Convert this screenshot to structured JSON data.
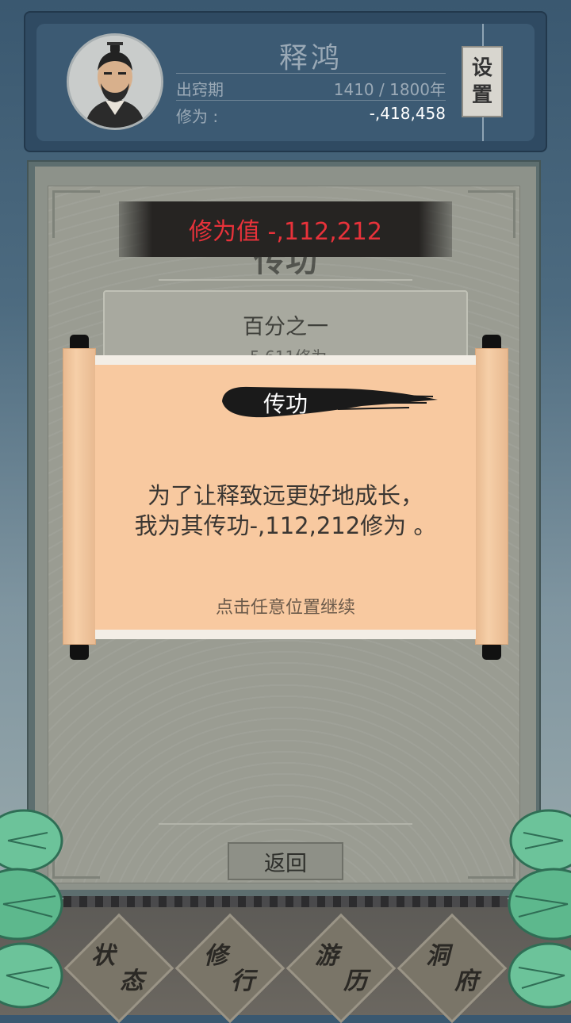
{
  "player": {
    "name": "释鸿",
    "stage_label": "出窍期",
    "stage_value": "1410 / 1800年",
    "cultivation_label": "修为 :",
    "cultivation_value": "-,418,458",
    "settings_char1": "设",
    "settings_char2": "置"
  },
  "panel": {
    "banner_text": "修为值 -,112,212",
    "title": "传功",
    "option_title": "百分之一",
    "option_sub": "-5,611修为",
    "back_label": "返回"
  },
  "dialog": {
    "title": "传功",
    "message_line1": "为了让释致远更好地成长，",
    "message_line2": "我为其传功-,112,212修为 。",
    "hint": "点击任意位置继续"
  },
  "nav": {
    "items": [
      {
        "label_top": "状",
        "label_bottom": "态"
      },
      {
        "label_top": "修",
        "label_bottom": "行"
      },
      {
        "label_top": "游",
        "label_bottom": "历"
      },
      {
        "label_top": "洞",
        "label_bottom": "府"
      }
    ]
  },
  "colors": {
    "banner_text": "#e8323a",
    "scroll_paper": "#f8c9a0",
    "header_bg": "#3c5a73"
  }
}
